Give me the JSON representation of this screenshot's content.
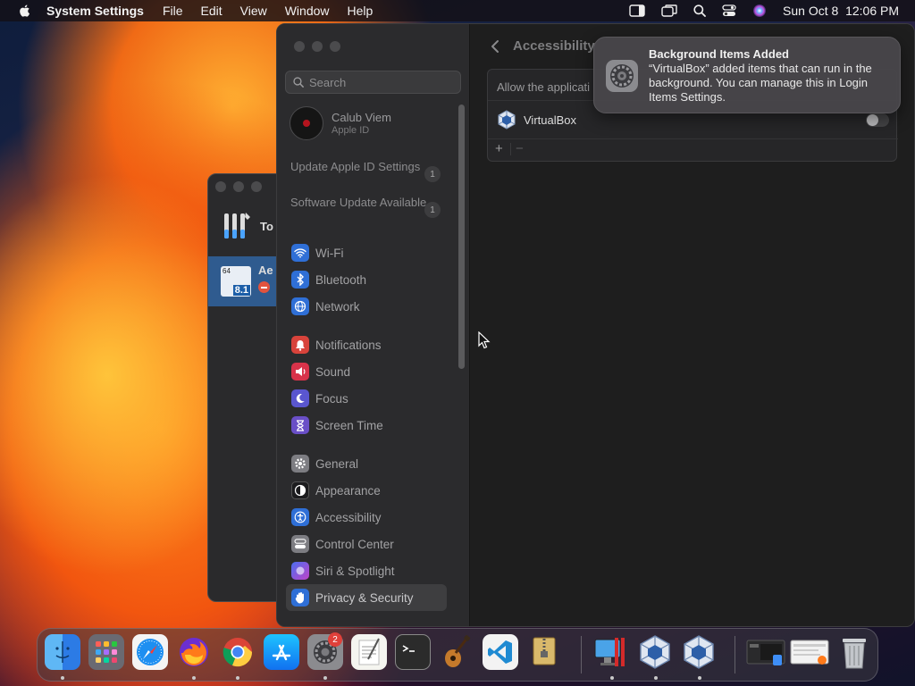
{
  "menubar": {
    "app_name": "System Settings",
    "menus": [
      "File",
      "Edit",
      "View",
      "Window",
      "Help"
    ],
    "date_time": "Sun Oct 8  12:06 PM"
  },
  "bg_window": {
    "row1_label": "To",
    "row2_label": "Ae",
    "row2_badge": "8.1",
    "row2_badge_top": "64"
  },
  "sidebar": {
    "search_placeholder": "Search",
    "profile": {
      "name": "Calub Viem",
      "subtitle": "Apple ID"
    },
    "notices": [
      {
        "label": "Update Apple ID Settings",
        "count": "1"
      },
      {
        "label": "Software Update Available",
        "count": "1"
      }
    ],
    "items": [
      {
        "label": "Wi-Fi",
        "icon": "wifi-icon",
        "color": "#2f7cf6"
      },
      {
        "label": "Bluetooth",
        "icon": "bluetooth-icon",
        "color": "#2f7cf6"
      },
      {
        "label": "Network",
        "icon": "globe-icon",
        "color": "#2f7cf6"
      },
      {
        "label": "Notifications",
        "icon": "bell-icon",
        "color": "#e8453c"
      },
      {
        "label": "Sound",
        "icon": "speaker-icon",
        "color": "#e8334a"
      },
      {
        "label": "Focus",
        "icon": "moon-icon",
        "color": "#5b5bd6"
      },
      {
        "label": "Screen Time",
        "icon": "hourglass-icon",
        "color": "#6a4fc7"
      },
      {
        "label": "General",
        "icon": "gear-icon",
        "color": "#8e8e93"
      },
      {
        "label": "Appearance",
        "icon": "appearance-icon",
        "color": "#1c1c1e"
      },
      {
        "label": "Accessibility",
        "icon": "accessibility-icon",
        "color": "#2f7cf6"
      },
      {
        "label": "Control Center",
        "icon": "control-center-icon",
        "color": "#8e8e93"
      },
      {
        "label": "Siri & Spotlight",
        "icon": "siri-icon",
        "color": "#7a4bd8"
      },
      {
        "label": "Privacy & Security",
        "icon": "hand-icon",
        "color": "#2f7cf6"
      }
    ],
    "selected": "Privacy & Security"
  },
  "content": {
    "title": "Accessibility",
    "panel_header": "Allow the applicati",
    "app_row": {
      "label": "VirtualBox",
      "toggle_on": false
    },
    "add_label": "+",
    "remove_label": "−"
  },
  "notification": {
    "title": "Background Items Added",
    "body": "“VirtualBox” added items that can run in the background. You can manage this in Login Items Settings."
  },
  "dock": {
    "apps": [
      {
        "name": "Finder",
        "icon": "finder-icon",
        "running": true
      },
      {
        "name": "Launchpad",
        "icon": "launchpad-icon",
        "running": false
      },
      {
        "name": "Safari",
        "icon": "safari-icon",
        "running": false
      },
      {
        "name": "Firefox",
        "icon": "firefox-icon",
        "running": true
      },
      {
        "name": "Chrome",
        "icon": "chrome-icon",
        "running": true
      },
      {
        "name": "App Store",
        "icon": "app-store-icon",
        "running": false
      },
      {
        "name": "System Settings",
        "icon": "system-settings-icon",
        "running": true,
        "badge": "2"
      },
      {
        "name": "TextEdit",
        "icon": "textedit-icon",
        "running": false
      },
      {
        "name": "Terminal",
        "icon": "terminal-icon",
        "running": false
      },
      {
        "name": "GarageBand",
        "icon": "garageband-icon",
        "running": false
      },
      {
        "name": "VS Code",
        "icon": "vscode-icon",
        "running": false
      },
      {
        "name": "Archive Utility",
        "icon": "archive-icon",
        "running": false
      },
      {
        "name": "Remote Desktop",
        "icon": "remote-desktop-icon",
        "running": true
      },
      {
        "name": "VirtualBox",
        "icon": "virtualbox-icon",
        "running": true
      },
      {
        "name": "VirtualBox VM",
        "icon": "virtualbox-icon",
        "running": true
      },
      {
        "name": "Window Thumbnail 1",
        "icon": "window-thumbnail-icon",
        "running": false
      },
      {
        "name": "Window Thumbnail 2",
        "icon": "window-thumbnail-icon",
        "running": false
      },
      {
        "name": "Trash",
        "icon": "trash-icon",
        "running": false
      }
    ]
  }
}
